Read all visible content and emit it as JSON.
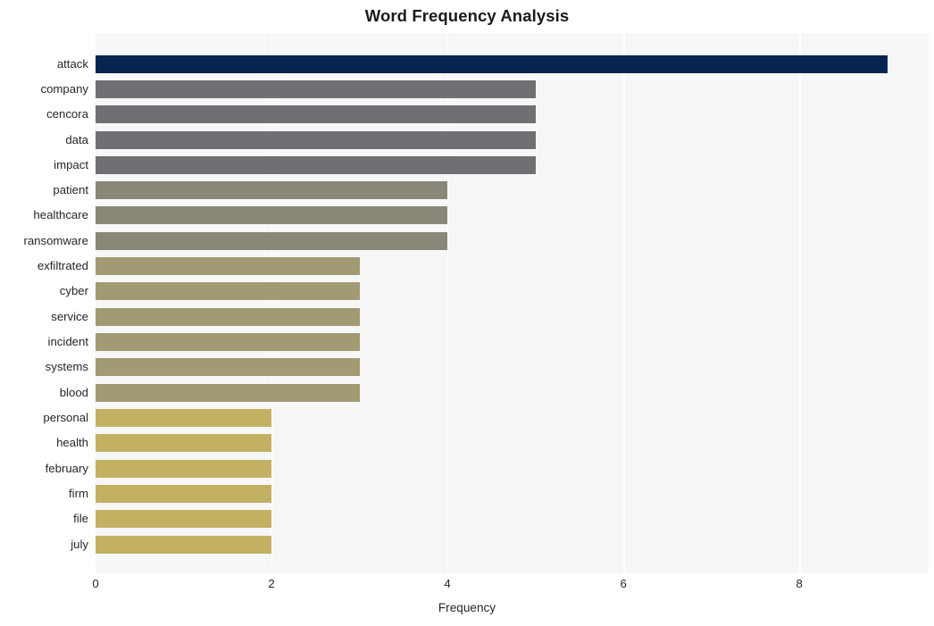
{
  "chart_data": {
    "type": "bar",
    "orientation": "horizontal",
    "title": "Word Frequency Analysis",
    "xlabel": "Frequency",
    "ylabel": "",
    "categories": [
      "attack",
      "company",
      "cencora",
      "data",
      "impact",
      "patient",
      "healthcare",
      "ransomware",
      "exfiltrated",
      "cyber",
      "service",
      "incident",
      "systems",
      "blood",
      "personal",
      "health",
      "february",
      "firm",
      "file",
      "july"
    ],
    "values": [
      9,
      5,
      5,
      5,
      5,
      4,
      4,
      4,
      3,
      3,
      3,
      3,
      3,
      3,
      2,
      2,
      2,
      2,
      2,
      2
    ],
    "bar_colors": [
      "#05244f",
      "#6e7073",
      "#6e7073",
      "#6e7073",
      "#6e7073",
      "#8a8779",
      "#8a8779",
      "#8a8779",
      "#a29a73",
      "#a29a73",
      "#a29a73",
      "#a29a73",
      "#a29a73",
      "#a29a73",
      "#c2b163",
      "#c2b163",
      "#c2b163",
      "#c2b163",
      "#c2b163",
      "#c2b163"
    ],
    "xlim": [
      0,
      9.47
    ],
    "x_ticks": [
      0,
      2,
      4,
      6,
      8
    ],
    "x_tick_labels": [
      "0",
      "2",
      "4",
      "6",
      "8"
    ],
    "grid": "vertical-only",
    "legend": "none",
    "plot_background": "#f7f7f7",
    "gridline_color": "#ffffff",
    "figure_background": "#ffffff"
  }
}
